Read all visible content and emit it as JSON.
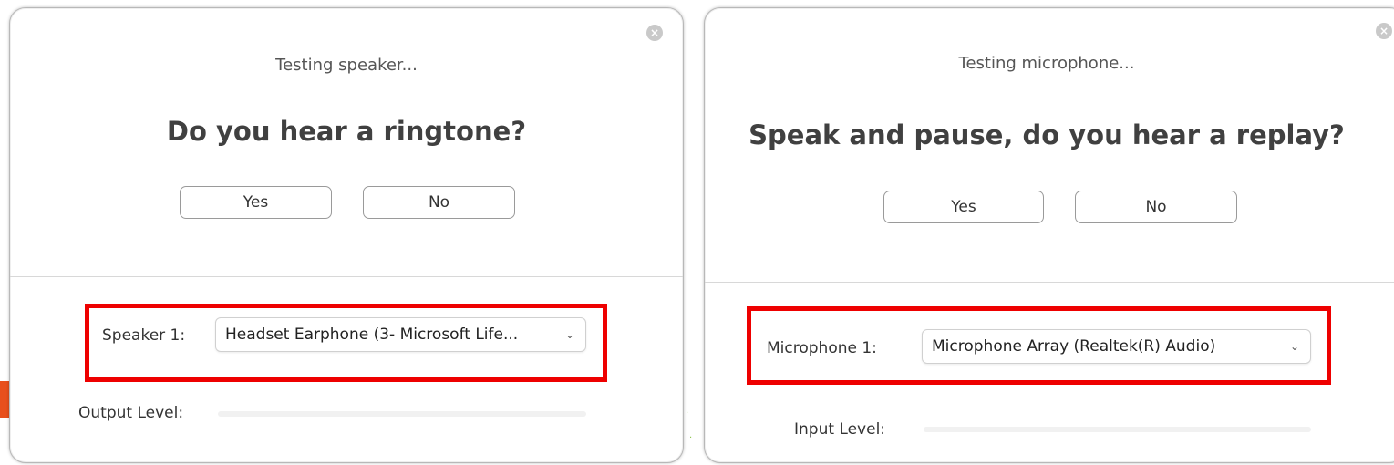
{
  "speaker_dialog": {
    "status": "Testing speaker...",
    "question": "Do you hear a ringtone?",
    "yes_label": "Yes",
    "no_label": "No",
    "device_label": "Speaker 1:",
    "device_value": "Headset Earphone (3- Microsoft Life...",
    "level_label": "Output Level:",
    "level_value": 0
  },
  "microphone_dialog": {
    "status": "Testing microphone...",
    "question": "Speak and pause, do you hear a replay?",
    "yes_label": "Yes",
    "no_label": "No",
    "device_label": "Microphone 1:",
    "device_value": "Microphone Array (Realtek(R) Audio)",
    "level_label": "Input Level:",
    "level_value": 0
  },
  "icons": {
    "close": "close-icon",
    "dropdown": "chevron-down-icon"
  },
  "colors": {
    "highlight": "#ee0000",
    "accent_tab": "#e8501c"
  }
}
